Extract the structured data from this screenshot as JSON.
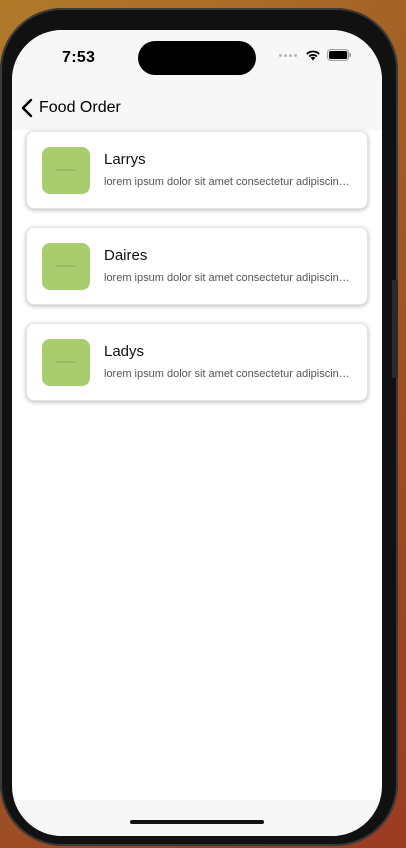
{
  "status_bar": {
    "time": "7:53",
    "icons": [
      "cellular-signal-icon",
      "wifi-icon",
      "battery-icon"
    ]
  },
  "nav": {
    "back_icon": "chevron-left-icon",
    "title": "Food Order"
  },
  "items": [
    {
      "title": "Larrys",
      "subtitle": "lorem ipsum dolor sit amet consectetur adipiscing elit",
      "thumb_color": "#a8cc6e"
    },
    {
      "title": "Daires",
      "subtitle": "lorem ipsum dolor sit amet consectetur adipiscing elit",
      "thumb_color": "#a8cc6e"
    },
    {
      "title": "Ladys",
      "subtitle": "lorem ipsum dolor sit amet consectetur adipiscing elit",
      "thumb_color": "#a8cc6e"
    }
  ],
  "colors": {
    "nav_background": "#f7f7f7",
    "thumbnail": "#a8cc6e"
  }
}
